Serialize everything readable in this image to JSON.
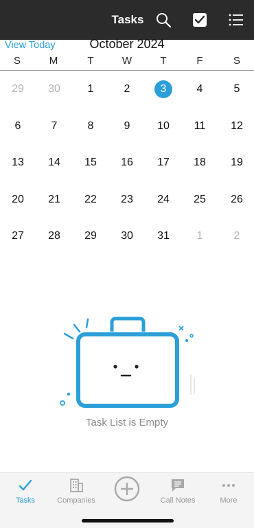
{
  "header": {
    "title": "Tasks",
    "icons": [
      "search-icon",
      "checkbox-icon",
      "list-icon"
    ]
  },
  "calendar": {
    "view_today_label": "View Today",
    "month_label": "October 2024",
    "weekdays": [
      "S",
      "M",
      "T",
      "W",
      "T",
      "F",
      "S"
    ],
    "selected_day": "3",
    "accent_color": "#2b9fd8",
    "weeks": [
      [
        "29",
        "30",
        "1",
        "2",
        "3",
        "4",
        "5"
      ],
      [
        "6",
        "7",
        "8",
        "9",
        "10",
        "11",
        "12"
      ],
      [
        "13",
        "14",
        "15",
        "16",
        "17",
        "18",
        "19"
      ],
      [
        "20",
        "21",
        "22",
        "23",
        "24",
        "25",
        "26"
      ],
      [
        "27",
        "28",
        "29",
        "30",
        "31",
        "1",
        "2"
      ]
    ]
  },
  "empty_state": {
    "message": "Task List is Empty",
    "icon": "briefcase-icon"
  },
  "tabbar": {
    "tabs": [
      {
        "label": "Tasks",
        "icon": "check-icon"
      },
      {
        "label": "Companies",
        "icon": "building-icon"
      },
      {
        "label": "",
        "icon": "add-circle-icon"
      },
      {
        "label": "Call Notes",
        "icon": "chat-bubble-icon"
      },
      {
        "label": "More",
        "icon": "more-dots-icon"
      }
    ],
    "active_tab": "Tasks"
  }
}
